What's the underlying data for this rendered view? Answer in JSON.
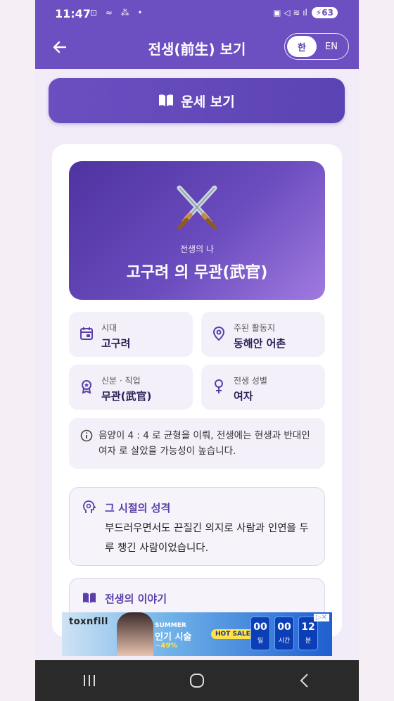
{
  "status_bar": {
    "time": "11:47",
    "battery": "63",
    "left_icons": "⊡ ≈ ⁂ •",
    "right_icons": "▣ ◁ ≋ ıl"
  },
  "app_bar": {
    "title": "전생(前生) 보기",
    "lang_ko": "한",
    "lang_en": "EN",
    "selected_lang": "ko"
  },
  "fortune_button": {
    "label": "운세 보기"
  },
  "hero": {
    "subtitle": "전생의 나",
    "title": "고구려 의 무관(武官)"
  },
  "info": [
    {
      "icon": "calendar-icon",
      "label": "시대",
      "value": "고구려"
    },
    {
      "icon": "location-pin-icon",
      "label": "주된 활동지",
      "value": "동해안 어촌"
    },
    {
      "icon": "badge-icon",
      "label": "신분 · 직업",
      "value": "무관(武官)"
    },
    {
      "icon": "female-symbol-icon",
      "label": "전생 성별",
      "value": "여자"
    }
  ],
  "note": {
    "text": "음양이 4 : 4 로 균형을 이뤄, 전생에는 현생과 반대인 여자 로 살았을 가능성이 높습니다."
  },
  "personality": {
    "title": "그 시절의 성격",
    "body": "부드러우면서도 끈질긴 의지로 사람과 인연을 두루 챙긴 사람이었습니다."
  },
  "story": {
    "title": "전생의 이야기"
  },
  "ad": {
    "brand": "toxnfill",
    "summer": "SUMMER",
    "headline": "인기 시술",
    "discount": "~49%",
    "hot_sale": "HOT SALE",
    "timer": [
      {
        "num": "00",
        "unit": "일"
      },
      {
        "num": "00",
        "unit": "시간"
      },
      {
        "num": "12",
        "unit": "분"
      }
    ],
    "choice": "▷✕"
  },
  "colors": {
    "primary": "#6c4fc0",
    "accent_text": "#5a3fa8",
    "card_bg": "#f3f0fa"
  }
}
